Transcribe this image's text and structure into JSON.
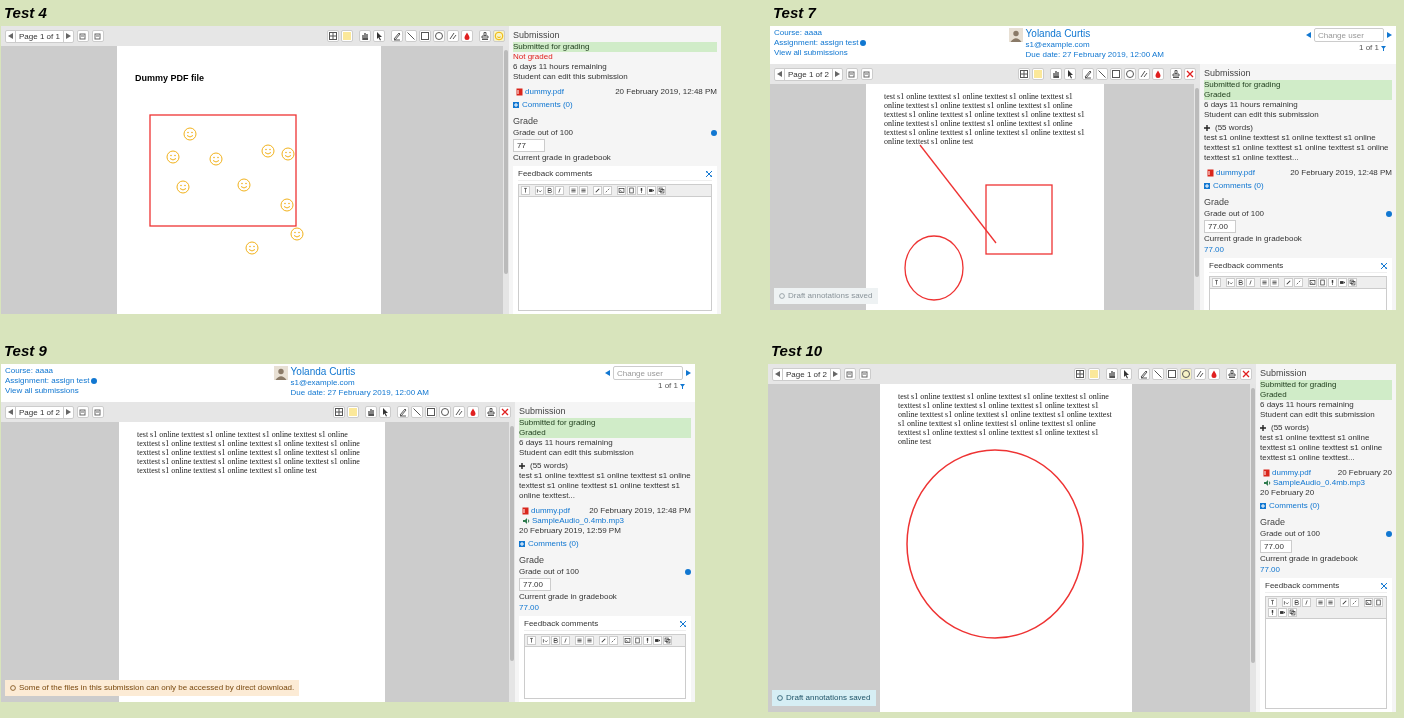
{
  "panels": [
    {
      "label": "Test 4",
      "toolbar": {
        "page": "Page 1 of 1",
        "tools": [
          {
            "kind": "grid",
            "selected": false
          },
          {
            "kind": "note",
            "selected": false
          },
          {
            "kind": "hand",
            "selected": false
          },
          {
            "kind": "pointer",
            "selected": false
          },
          {
            "kind": "pen",
            "selected": false
          },
          {
            "kind": "line",
            "selected": false
          },
          {
            "kind": "rect",
            "selected": false
          },
          {
            "kind": "oval",
            "selected": false
          },
          {
            "kind": "highlight",
            "selected": false
          },
          {
            "kind": "color",
            "selected": false
          },
          {
            "kind": "stamp",
            "selected": false
          },
          {
            "kind": "smiley",
            "selected": true
          }
        ]
      },
      "document": {
        "title": "Dummy PDF file"
      },
      "annotations": {
        "kind": "smileys-in-rectangle"
      },
      "submission": {
        "heading": "Submission",
        "statuses": [
          {
            "text": "Submitted for grading",
            "kind": "highlight"
          },
          {
            "text": "Not graded",
            "kind": "alert"
          }
        ],
        "remaining": "6 days 11 hours remaining",
        "editable": "Student can edit this submission",
        "files": [
          {
            "name": "dummy.pdf",
            "date": "20 February 2019, 12:48 PM",
            "kind": "pdf"
          }
        ],
        "comments": "Comments (0)"
      },
      "grade": {
        "heading": "Grade",
        "label": "Grade out of 100",
        "value": "77",
        "gradebook_label": "Current grade in gradebook"
      },
      "feedback": {
        "title": "Feedback comments"
      }
    },
    {
      "label": "Test 7",
      "header": {
        "course": "Course: aaaa",
        "assignment": "Assignment: assign test",
        "view_all": "View all submissions",
        "user": "Yolanda Curtis",
        "email": "s1@example.com",
        "due": "Due date: 27 February 2019, 12:00 AM",
        "change_user": {
          "placeholder": "Change user",
          "count": "1 of 1"
        }
      },
      "toolbar": {
        "page": "Page 1 of 2",
        "tools": [
          {
            "kind": "grid",
            "selected": false
          },
          {
            "kind": "note",
            "selected": false
          },
          {
            "kind": "hand",
            "selected": false
          },
          {
            "kind": "pointer",
            "selected": false
          },
          {
            "kind": "pen",
            "selected": false
          },
          {
            "kind": "line",
            "selected": false
          },
          {
            "kind": "rect",
            "selected": false
          },
          {
            "kind": "oval",
            "selected": false
          },
          {
            "kind": "highlight",
            "selected": false
          },
          {
            "kind": "color",
            "selected": false
          },
          {
            "kind": "stamp",
            "selected": false
          },
          {
            "kind": "delete",
            "selected": false
          }
        ]
      },
      "document": {
        "text": "test s1 online texttest s1 online texttest s1 online texttest s1 online texttest s1 online texttest s1 online texttest s1 online texttest s1 online texttest s1 online texttest s1 online texttest s1 online texttest s1 online texttest s1 online texttest s1 online texttest s1 online texttest s1 online texttest s1 online texttest s1 online texttest s1 online test"
      },
      "annotations": {
        "kind": "line-rectangle-circle"
      },
      "submission": {
        "heading": "Submission",
        "statuses": [
          {
            "text": "Submitted for grading",
            "kind": "highlight"
          },
          {
            "text": "Graded",
            "kind": "highlight"
          }
        ],
        "remaining": "6 days 11 hours remaining",
        "editable": "Student can edit this submission",
        "online_text": {
          "words": "(55 words)",
          "preview": "test s1 online texttest s1 online texttest s1 online texttest s1 online texttest s1 online texttest s1 online texttest s1 online texttest..."
        },
        "files": [
          {
            "name": "dummy.pdf",
            "date": "20 February 2019, 12:48 PM",
            "kind": "pdf"
          }
        ],
        "comments": "Comments (0)"
      },
      "grade": {
        "heading": "Grade",
        "label": "Grade out of 100",
        "value": "77.00",
        "gradebook_label": "Current grade in gradebook",
        "gradebook_value": "77.00"
      },
      "feedback": {
        "title": "Feedback comments"
      },
      "toast": {
        "text": "Draft annotations saved",
        "kind": "faded"
      }
    },
    {
      "label": "Test 9",
      "header": {
        "course": "Course: aaaa",
        "assignment": "Assignment: assign test",
        "view_all": "View all submissions",
        "user": "Yolanda Curtis",
        "email": "s1@example.com",
        "due": "Due date: 27 February 2019, 12:00 AM",
        "change_user": {
          "placeholder": "Change user",
          "count": "1 of 1"
        }
      },
      "toolbar": {
        "page": "Page 1 of 2",
        "tools": [
          {
            "kind": "grid",
            "selected": false
          },
          {
            "kind": "note",
            "selected": false
          },
          {
            "kind": "hand",
            "selected": false
          },
          {
            "kind": "pointer",
            "selected": false
          },
          {
            "kind": "pen",
            "selected": false
          },
          {
            "kind": "line",
            "selected": false
          },
          {
            "kind": "rect",
            "selected": false
          },
          {
            "kind": "oval",
            "selected": false
          },
          {
            "kind": "highlight",
            "selected": false
          },
          {
            "kind": "color",
            "selected": false
          },
          {
            "kind": "stamp",
            "selected": false
          },
          {
            "kind": "delete",
            "selected": false
          }
        ]
      },
      "document": {
        "text": "test s1 online texttest s1 online texttest s1 online texttest s1 online texttest s1 online texttest s1 online texttest s1 online texttest s1 online texttest s1 online texttest s1 online texttest s1 online texttest s1 online texttest s1 online texttest s1 online texttest s1 online texttest s1 online texttest s1 online texttest s1 online texttest s1 online test"
      },
      "submission": {
        "heading": "Submission",
        "statuses": [
          {
            "text": "Submitted for grading",
            "kind": "highlight"
          },
          {
            "text": "Graded",
            "kind": "highlight"
          }
        ],
        "remaining": "6 days 11 hours remaining",
        "editable": "Student can edit this submission",
        "online_text": {
          "words": "(55 words)",
          "preview": "test s1 online texttest s1 online texttest s1 online texttest s1 online texttest s1 online texttest s1 online texttest..."
        },
        "files": [
          {
            "name": "dummy.pdf",
            "date": "20 February 2019, 12:48 PM",
            "kind": "pdf"
          },
          {
            "name": "SampleAudio_0.4mb.mp3",
            "date": "20 February 2019, 12:59 PM",
            "kind": "audio"
          }
        ],
        "comments": "Comments (0)"
      },
      "grade": {
        "heading": "Grade",
        "label": "Grade out of 100",
        "value": "77.00",
        "gradebook_label": "Current grade in gradebook",
        "gradebook_value": "77.00"
      },
      "feedback": {
        "title": "Feedback comments"
      },
      "toast": {
        "text": "Some of the files in this submission can only be accessed by direct download.",
        "kind": "warning"
      }
    },
    {
      "label": "Test 10",
      "toolbar": {
        "page": "Page 1 of 2",
        "tools": [
          {
            "kind": "grid",
            "selected": false
          },
          {
            "kind": "note",
            "selected": false
          },
          {
            "kind": "hand",
            "selected": false
          },
          {
            "kind": "pointer",
            "selected": false
          },
          {
            "kind": "pen",
            "selected": false
          },
          {
            "kind": "line",
            "selected": false
          },
          {
            "kind": "rect",
            "selected": false
          },
          {
            "kind": "oval",
            "selected": true
          },
          {
            "kind": "highlight",
            "selected": false
          },
          {
            "kind": "color",
            "selected": false
          },
          {
            "kind": "stamp",
            "selected": false
          },
          {
            "kind": "delete",
            "selected": false
          }
        ]
      },
      "document": {
        "text": "test s1 online texttest s1 online texttest s1 online texttest s1 online texttest s1 online texttest s1 online texttest s1 online texttest s1 online texttest s1 online texttest s1 online texttest s1 online texttest s1 online texttest s1 online texttest s1 online texttest s1 online texttest s1 online texttest s1 online texttest s1 online texttest s1 online test"
      },
      "annotations": {
        "kind": "circle"
      },
      "submission": {
        "heading": "Submission",
        "statuses": [
          {
            "text": "Submitted for grading",
            "kind": "highlight"
          },
          {
            "text": "Graded",
            "kind": "highlight"
          }
        ],
        "remaining": "6 days 11 hours remaining",
        "editable": "Student can edit this submission",
        "online_text": {
          "words": "(55 words)",
          "preview": "test s1 online texttest s1 online texttest s1 online texttest s1 online texttest s1 online texttest..."
        },
        "files": [
          {
            "name": "dummy.pdf",
            "date": "20 February 20",
            "kind": "pdf"
          },
          {
            "name": "SampleAudio_0.4mb.mp3",
            "date": "20 February 20",
            "kind": "audio"
          }
        ],
        "comments": "Comments (0)"
      },
      "grade": {
        "heading": "Grade",
        "label": "Grade out of 100",
        "value": "77.00",
        "gradebook_label": "Current grade in gradebook",
        "gradebook_value": "77.00"
      },
      "feedback": {
        "title": "Feedback comments"
      },
      "toast": {
        "text": "Draft annotations saved",
        "kind": "info"
      }
    }
  ]
}
